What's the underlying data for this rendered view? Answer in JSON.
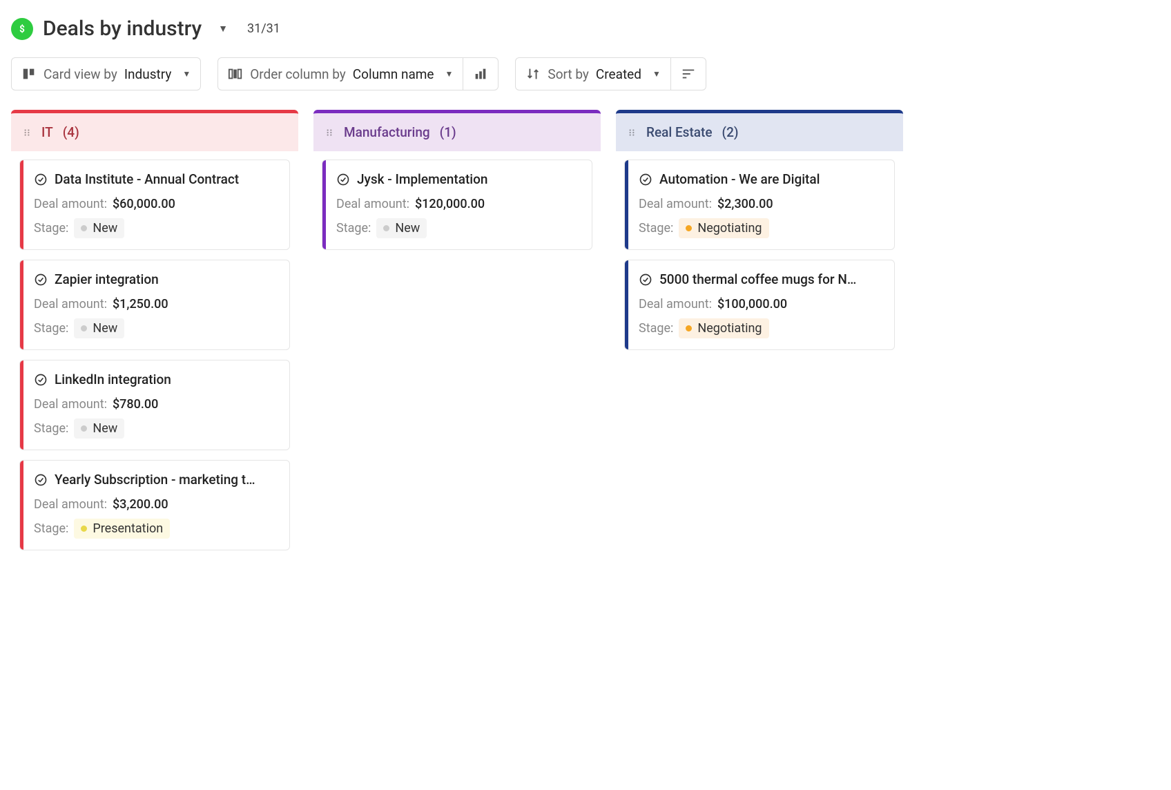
{
  "header": {
    "title": "Deals by industry",
    "count": "31/31"
  },
  "toolbar": {
    "card_view": {
      "label": "Card view by",
      "value": "Industry"
    },
    "order": {
      "label": "Order column by",
      "value": "Column name"
    },
    "sort": {
      "label": "Sort by",
      "value": "Created"
    }
  },
  "labels": {
    "deal_amount": "Deal amount:",
    "stage": "Stage:"
  },
  "columns": [
    {
      "id": "it",
      "title": "IT",
      "count": "(4)",
      "cards": [
        {
          "title": "Data Institute - Annual Contract",
          "amount": "$60,000.00",
          "stage": "New",
          "stage_class": "stage-new"
        },
        {
          "title": "Zapier integration",
          "amount": "$1,250.00",
          "stage": "New",
          "stage_class": "stage-new"
        },
        {
          "title": "LinkedIn integration",
          "amount": "$780.00",
          "stage": "New",
          "stage_class": "stage-new"
        },
        {
          "title": "Yearly Subscription - marketing t…",
          "amount": "$3,200.00",
          "stage": "Presentation",
          "stage_class": "stage-presentation"
        }
      ]
    },
    {
      "id": "mfg",
      "title": "Manufacturing",
      "count": "(1)",
      "cards": [
        {
          "title": "Jysk - Implementation",
          "amount": "$120,000.00",
          "stage": "New",
          "stage_class": "stage-new"
        }
      ]
    },
    {
      "id": "re",
      "title": "Real Estate",
      "count": "(2)",
      "cards": [
        {
          "title": "Automation - We are Digital",
          "amount": "$2,300.00",
          "stage": "Negotiating",
          "stage_class": "stage-negotiating"
        },
        {
          "title": "5000 thermal coffee mugs for N…",
          "amount": "$100,000.00",
          "stage": "Negotiating",
          "stage_class": "stage-negotiating"
        }
      ]
    }
  ]
}
